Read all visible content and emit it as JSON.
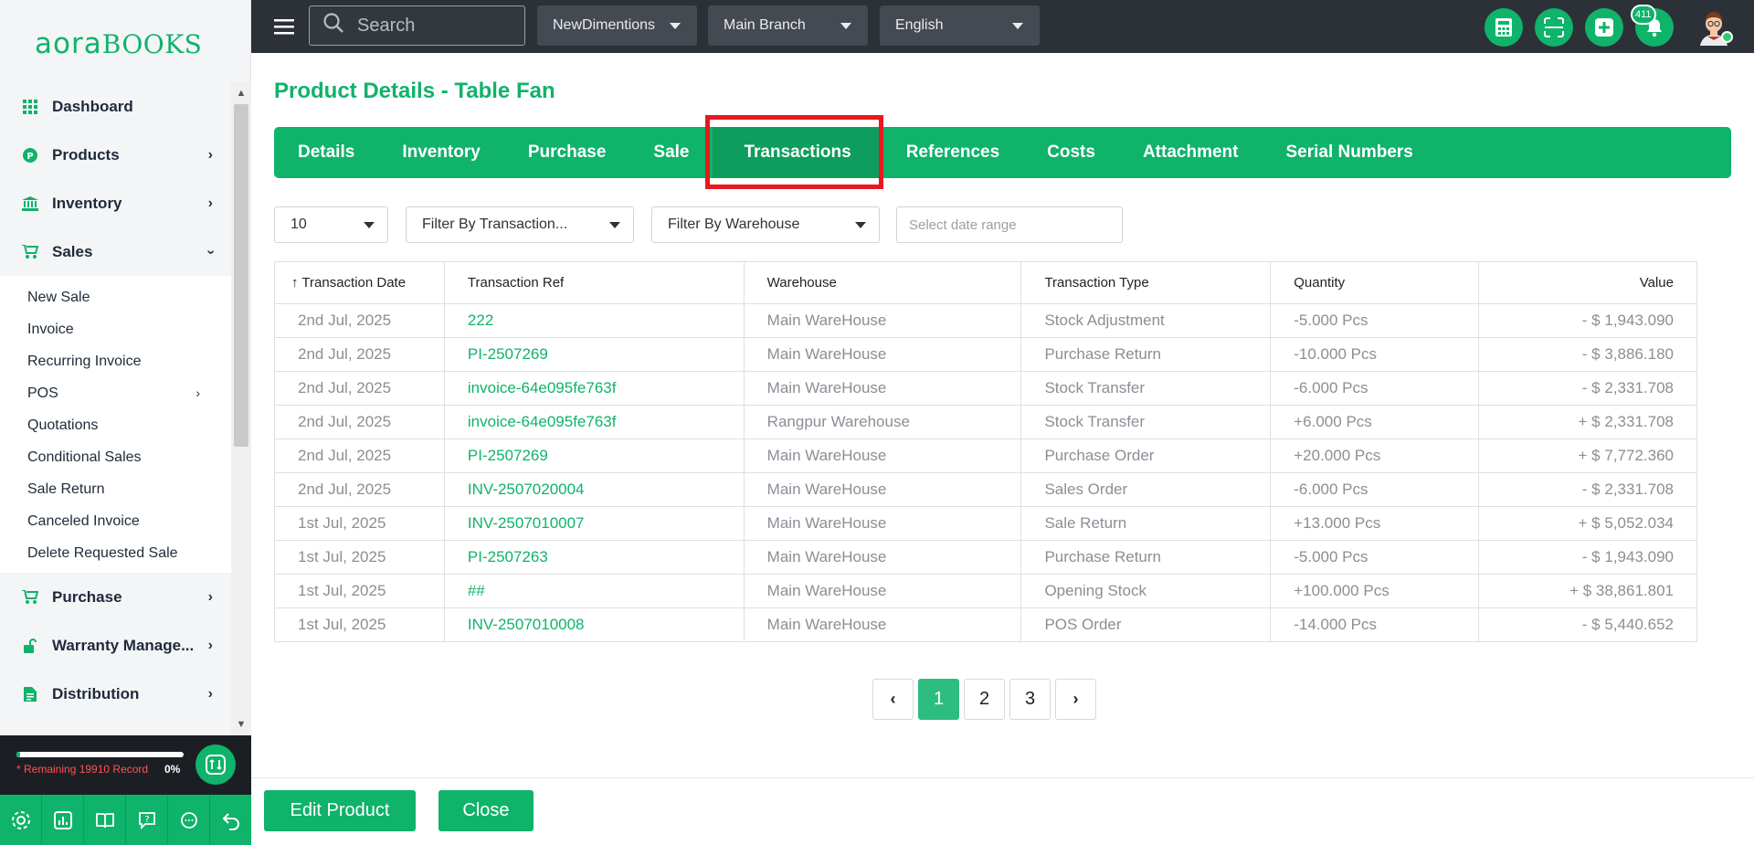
{
  "app": {
    "logo_part1": "aora",
    "logo_part2": "BOOKS"
  },
  "topbar": {
    "search_placeholder": "Search",
    "company": "NewDimentions",
    "branch": "Main Branch",
    "language": "English",
    "notification_count": "411"
  },
  "sidebar": {
    "items": [
      {
        "label": "Dashboard",
        "icon": "grid-icon"
      },
      {
        "label": "Products",
        "icon": "products-icon"
      },
      {
        "label": "Inventory",
        "icon": "bank-icon"
      },
      {
        "label": "Sales",
        "icon": "cart-icon"
      },
      {
        "label": "Purchase",
        "icon": "cart-icon"
      },
      {
        "label": "Warranty Manage...",
        "icon": "unlock-icon"
      },
      {
        "label": "Distribution",
        "icon": "document-icon"
      }
    ],
    "sales_sub": [
      "New Sale",
      "Invoice",
      "Recurring Invoice",
      "POS",
      "Quotations",
      "Conditional Sales",
      "Sale Return",
      "Canceled Invoice",
      "Delete Requested Sale"
    ],
    "footer": {
      "remaining": "* Remaining 19910 Record",
      "percent": "0%",
      "progress_fraction": 0.02
    }
  },
  "page": {
    "title": "Product Details - Table Fan",
    "tabs": [
      "Details",
      "Inventory",
      "Purchase",
      "Sale",
      "Transactions",
      "References",
      "Costs",
      "Attachment",
      "Serial Numbers"
    ],
    "active_tab": "Transactions"
  },
  "filters": {
    "page_size": "10",
    "transaction_filter": "Filter By Transaction...",
    "warehouse_filter": "Filter By Warehouse",
    "date_placeholder": "Select date range"
  },
  "table": {
    "columns": [
      "Transaction Date",
      "Transaction Ref",
      "Warehouse",
      "Transaction Type",
      "Quantity",
      "Value"
    ],
    "rows": [
      [
        "2nd Jul, 2025",
        "222",
        "Main WareHouse",
        "Stock Adjustment",
        "-5.000 Pcs",
        "- $ 1,943.090"
      ],
      [
        "2nd Jul, 2025",
        "PI-2507269",
        "Main WareHouse",
        "Purchase Return",
        "-10.000 Pcs",
        "- $ 3,886.180"
      ],
      [
        "2nd Jul, 2025",
        "invoice-64e095fe763f",
        "Main WareHouse",
        "Stock Transfer",
        "-6.000 Pcs",
        "- $ 2,331.708"
      ],
      [
        "2nd Jul, 2025",
        "invoice-64e095fe763f",
        "Rangpur Warehouse",
        "Stock Transfer",
        "+6.000 Pcs",
        "+ $ 2,331.708"
      ],
      [
        "2nd Jul, 2025",
        "PI-2507269",
        "Main WareHouse",
        "Purchase Order",
        "+20.000 Pcs",
        "+ $ 7,772.360"
      ],
      [
        "2nd Jul, 2025",
        "INV-2507020004",
        "Main WareHouse",
        "Sales Order",
        "-6.000 Pcs",
        "- $ 2,331.708"
      ],
      [
        "1st Jul, 2025",
        "INV-2507010007",
        "Main WareHouse",
        "Sale Return",
        "+13.000 Pcs",
        "+ $ 5,052.034"
      ],
      [
        "1st Jul, 2025",
        "PI-2507263",
        "Main WareHouse",
        "Purchase Return",
        "-5.000 Pcs",
        "- $ 1,943.090"
      ],
      [
        "1st Jul, 2025",
        "##",
        "Main WareHouse",
        "Opening Stock",
        "+100.000 Pcs",
        "+ $ 38,861.801"
      ],
      [
        "1st Jul, 2025",
        "INV-2507010008",
        "Main WareHouse",
        "POS Order",
        "-14.000 Pcs",
        "- $ 5,440.652"
      ]
    ]
  },
  "pagination": {
    "pages": [
      "1",
      "2",
      "3"
    ],
    "current": "1"
  },
  "actions": {
    "edit_label": "Edit Product",
    "close_label": "Close"
  },
  "colors": {
    "brand": "#0fb36a",
    "topbar": "#2c3138",
    "highlight": "#e8181e"
  }
}
